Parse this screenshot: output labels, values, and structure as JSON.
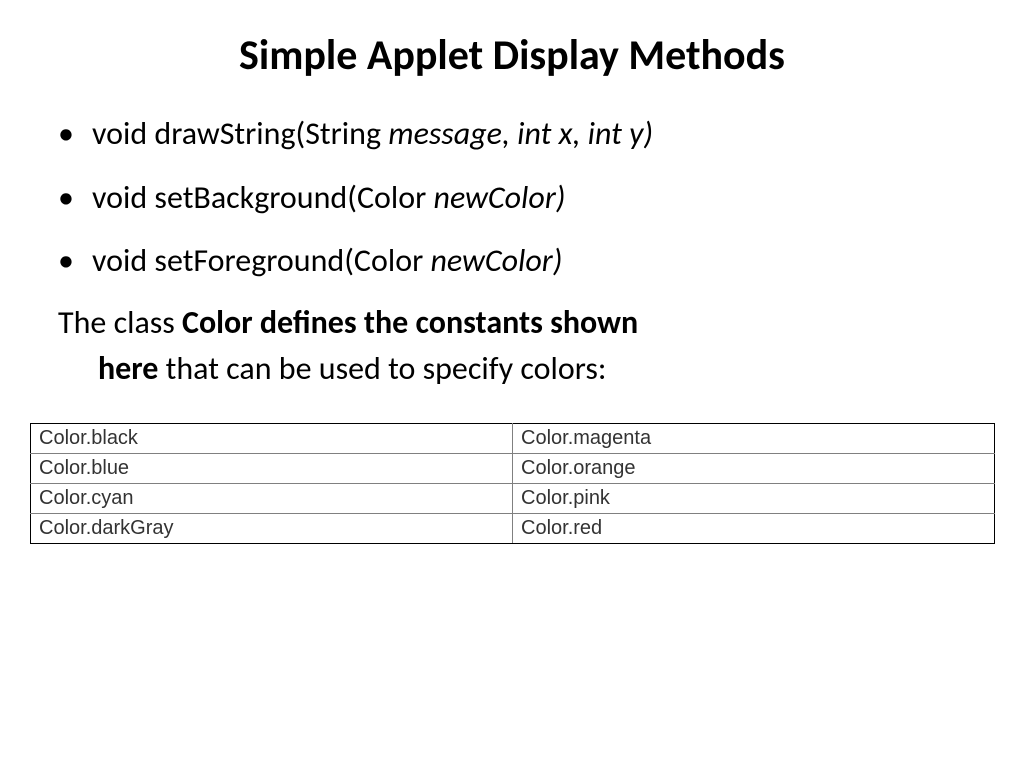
{
  "title": "Simple Applet Display Methods",
  "bullets": [
    {
      "prefix": "void drawString(String ",
      "italic": "message, int x, int y)"
    },
    {
      "prefix": "void setBackground(Color ",
      "italic": "newColor)"
    },
    {
      "prefix": "void setForeground(Color ",
      "italic": "newColor)"
    }
  ],
  "description": {
    "line1_plain": "The class ",
    "line1_bold": "Color defines the constants shown",
    "line2_bold": "here",
    "line2_plain": " that can be used to specify colors:"
  },
  "table": [
    {
      "left": "Color.black",
      "right": "Color.magenta"
    },
    {
      "left": "Color.blue",
      "right": "Color.orange"
    },
    {
      "left": "Color.cyan",
      "right": "Color.pink"
    },
    {
      "left": "Color.darkGray",
      "right": "Color.red"
    }
  ]
}
